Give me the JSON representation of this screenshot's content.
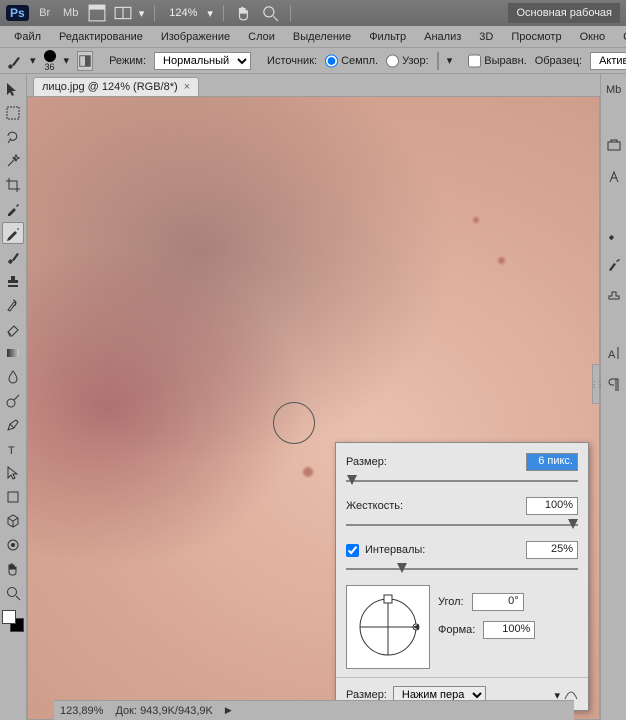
{
  "appbar": {
    "zoom": "124%",
    "workspace": "Основная рабочая"
  },
  "menu": {
    "file": "Файл",
    "edit": "Редактирование",
    "image": "Изображение",
    "layers": "Слои",
    "select": "Выделение",
    "filter": "Фильтр",
    "analysis": "Анализ",
    "threeD": "3D",
    "view": "Просмотр",
    "window": "Окно",
    "help": "Спр"
  },
  "optbar": {
    "brush_size": "36",
    "mode_label": "Режим:",
    "mode_value": "Нормальный",
    "source_label": "Источник:",
    "sample_label": "Семпл.",
    "pattern_label": "Узор:",
    "aligned_label": "Выравн.",
    "sample_menu_label": "Образец:",
    "sample_menu_value": "Активный"
  },
  "tab": {
    "title": "лицо.jpg @ 124% (RGB/8*)"
  },
  "panel": {
    "size_label": "Размер:",
    "size_value": "6 пикс.",
    "hardness_label": "Жесткость:",
    "hardness_value": "100%",
    "spacing_label": "Интервалы:",
    "spacing_value": "25%",
    "angle_label": "Угол:",
    "angle_value": "0°",
    "round_label": "Форма:",
    "round_value": "100%",
    "bottom_label": "Размер:",
    "bottom_value": "Нажим пера"
  },
  "status": {
    "zoom": "123,89%",
    "doc_label": "Док:",
    "doc_value": "943,9K/943,9K"
  },
  "icons": {
    "ps": "Ps",
    "bridge": "Br",
    "mb": "Mb",
    "layout": "layout-icon",
    "hand": "hand-icon",
    "zoom_dd": "▾",
    "close": "×"
  }
}
